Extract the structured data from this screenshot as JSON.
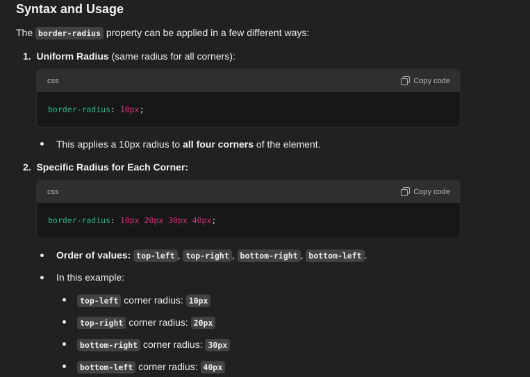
{
  "heading": "Syntax and Usage",
  "intro": {
    "before": "The",
    "code": "border-radius",
    "after": "property can be applied in a few different ways:"
  },
  "item1": {
    "number": "1.",
    "title": "Uniform Radius",
    "rest": "(same radius for all corners):",
    "code_block": {
      "lang": "css",
      "copy_label": "Copy code",
      "prop": "border-radius",
      "colon": ":",
      "value": "10px",
      "semi": ";"
    },
    "bullet": {
      "before": "This applies a 10px radius to",
      "bold": "all four corners",
      "after": "of the element."
    }
  },
  "item2": {
    "number": "2.",
    "title": "Specific Radius for Each Corner:",
    "code_block": {
      "lang": "css",
      "copy_label": "Copy code",
      "prop": "border-radius",
      "colon": ":",
      "value": "10px 20px 30px 40px",
      "semi": ";"
    },
    "order": {
      "label": "Order of values:",
      "values": [
        "top-left",
        "top-right",
        "bottom-right",
        "bottom-left"
      ],
      "sep": ",",
      "end": "."
    },
    "example_label": "In this example:",
    "sub_bullets": [
      {
        "corner": "top-left",
        "text": "corner radius:",
        "value": "10px"
      },
      {
        "corner": "top-right",
        "text": "corner radius:",
        "value": "20px"
      },
      {
        "corner": "bottom-right",
        "text": "corner radius:",
        "value": "30px"
      },
      {
        "corner": "bottom-left",
        "text": "corner radius:",
        "value": "40px"
      }
    ]
  }
}
